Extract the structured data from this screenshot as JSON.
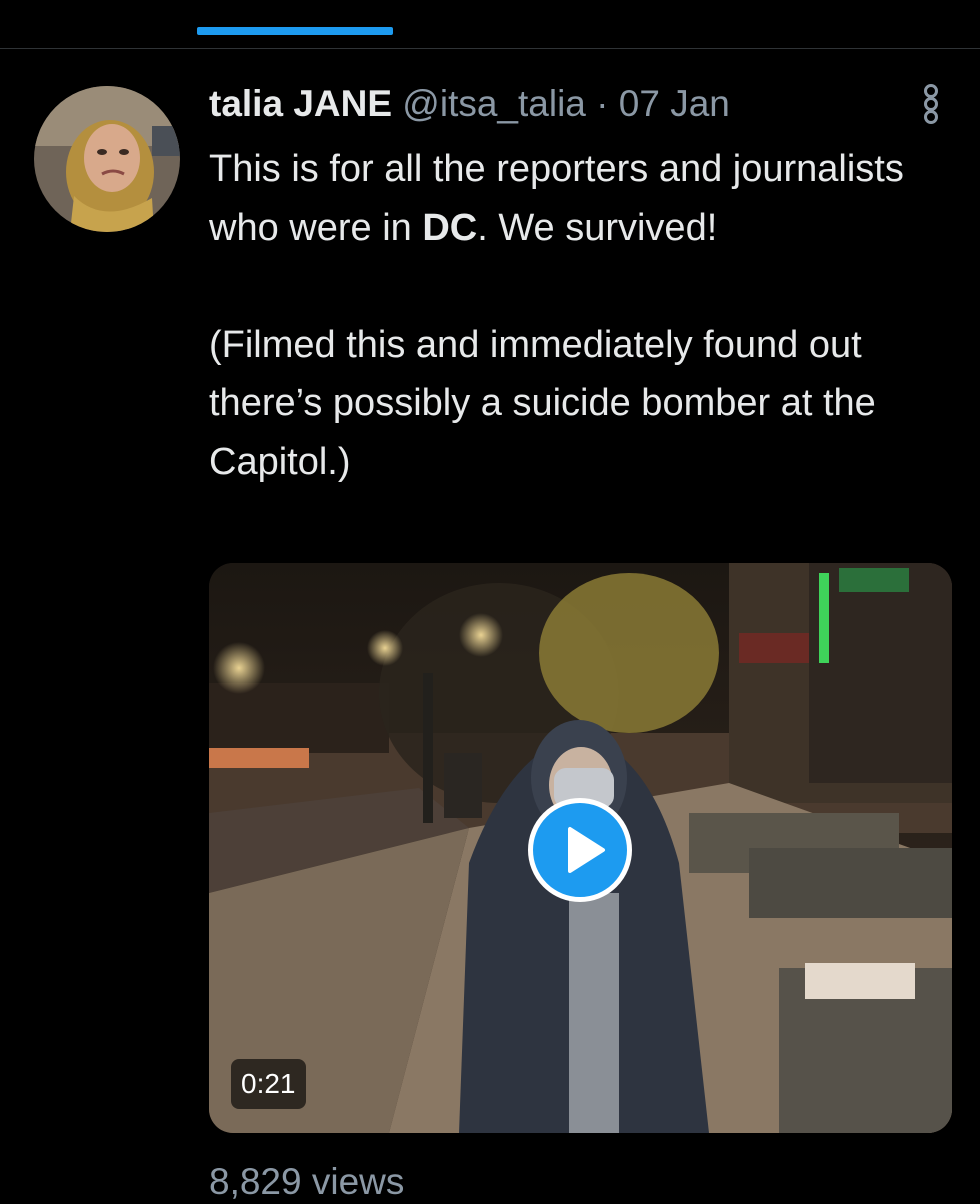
{
  "colors": {
    "background": "#000000",
    "accent": "#1d9bf0",
    "text": "#e7e9ea",
    "muted": "#8b98a5"
  },
  "tweet": {
    "author_name": "talia JANE",
    "handle": "@itsa_talia",
    "separator": "·",
    "date": "07 Jan",
    "text": {
      "line1_before": "This is for all the reporters and journalists who were in ",
      "line1_bold": "DC",
      "line1_after": ". We survived!",
      "para2": "(Filmed this and immediately found out there’s possibly a suicide bomber at the Capitol.)"
    },
    "media": {
      "type": "video",
      "duration": "0:21"
    },
    "views": "8,829 views",
    "more_icon": "more-options-icon"
  }
}
